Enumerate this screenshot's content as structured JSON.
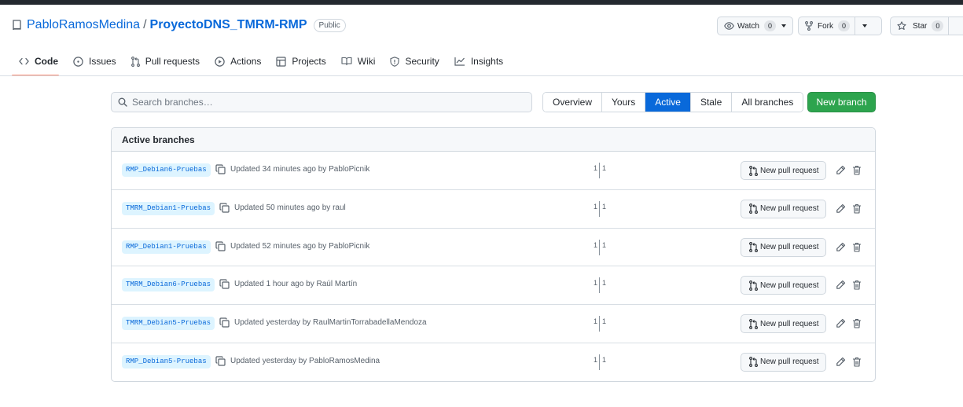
{
  "repo": {
    "owner": "PabloRamosMedina",
    "separator": "/",
    "name": "ProyectoDNS_TMRM-RMP",
    "visibility": "Public"
  },
  "header_buttons": {
    "watch_label": "Watch",
    "watch_count": "0",
    "fork_label": "Fork",
    "fork_count": "0",
    "star_label": "Star",
    "star_count": "0"
  },
  "tabs": [
    {
      "label": "Code",
      "icon": "code-icon",
      "active": true
    },
    {
      "label": "Issues",
      "icon": "issue-icon"
    },
    {
      "label": "Pull requests",
      "icon": "pull-request-icon"
    },
    {
      "label": "Actions",
      "icon": "play-icon"
    },
    {
      "label": "Projects",
      "icon": "table-icon"
    },
    {
      "label": "Wiki",
      "icon": "book-icon"
    },
    {
      "label": "Security",
      "icon": "shield-icon"
    },
    {
      "label": "Insights",
      "icon": "graph-icon"
    }
  ],
  "search": {
    "placeholder": "Search branches…"
  },
  "filters": [
    {
      "label": "Overview"
    },
    {
      "label": "Yours"
    },
    {
      "label": "Active",
      "selected": true
    },
    {
      "label": "Stale"
    },
    {
      "label": "All branches"
    }
  ],
  "new_branch_label": "New branch",
  "table": {
    "title": "Active branches",
    "new_pr_label": "New pull request",
    "rows": [
      {
        "branch": "RMP_Debian6-Pruebas",
        "updated": "Updated 34 minutes ago by PabloPicnik",
        "ahead": "1",
        "behind": "1"
      },
      {
        "branch": "TMRM_Debian1-Pruebas",
        "updated": "Updated 50 minutes ago by raul",
        "ahead": "1",
        "behind": "1"
      },
      {
        "branch": "RMP_Debian1-Pruebas",
        "updated": "Updated 52 minutes ago by PabloPicnik",
        "ahead": "1",
        "behind": "1"
      },
      {
        "branch": "TMRM_Debian6-Pruebas",
        "updated": "Updated 1 hour ago by Raúl Martín",
        "ahead": "1",
        "behind": "1"
      },
      {
        "branch": "TMRM_Debian5-Pruebas",
        "updated": "Updated yesterday by RaulMartinTorrabadellaMendoza",
        "ahead": "1",
        "behind": "1"
      },
      {
        "branch": "RMP_Debian5-Pruebas",
        "updated": "Updated yesterday by PabloRamosMedina",
        "ahead": "1",
        "behind": "1"
      }
    ]
  },
  "colors": {
    "accent": "#0969da",
    "primary_button": "#2da44e",
    "branch_tag_bg": "#ddf4ff",
    "active_tab_underline": "#fd8c73"
  }
}
